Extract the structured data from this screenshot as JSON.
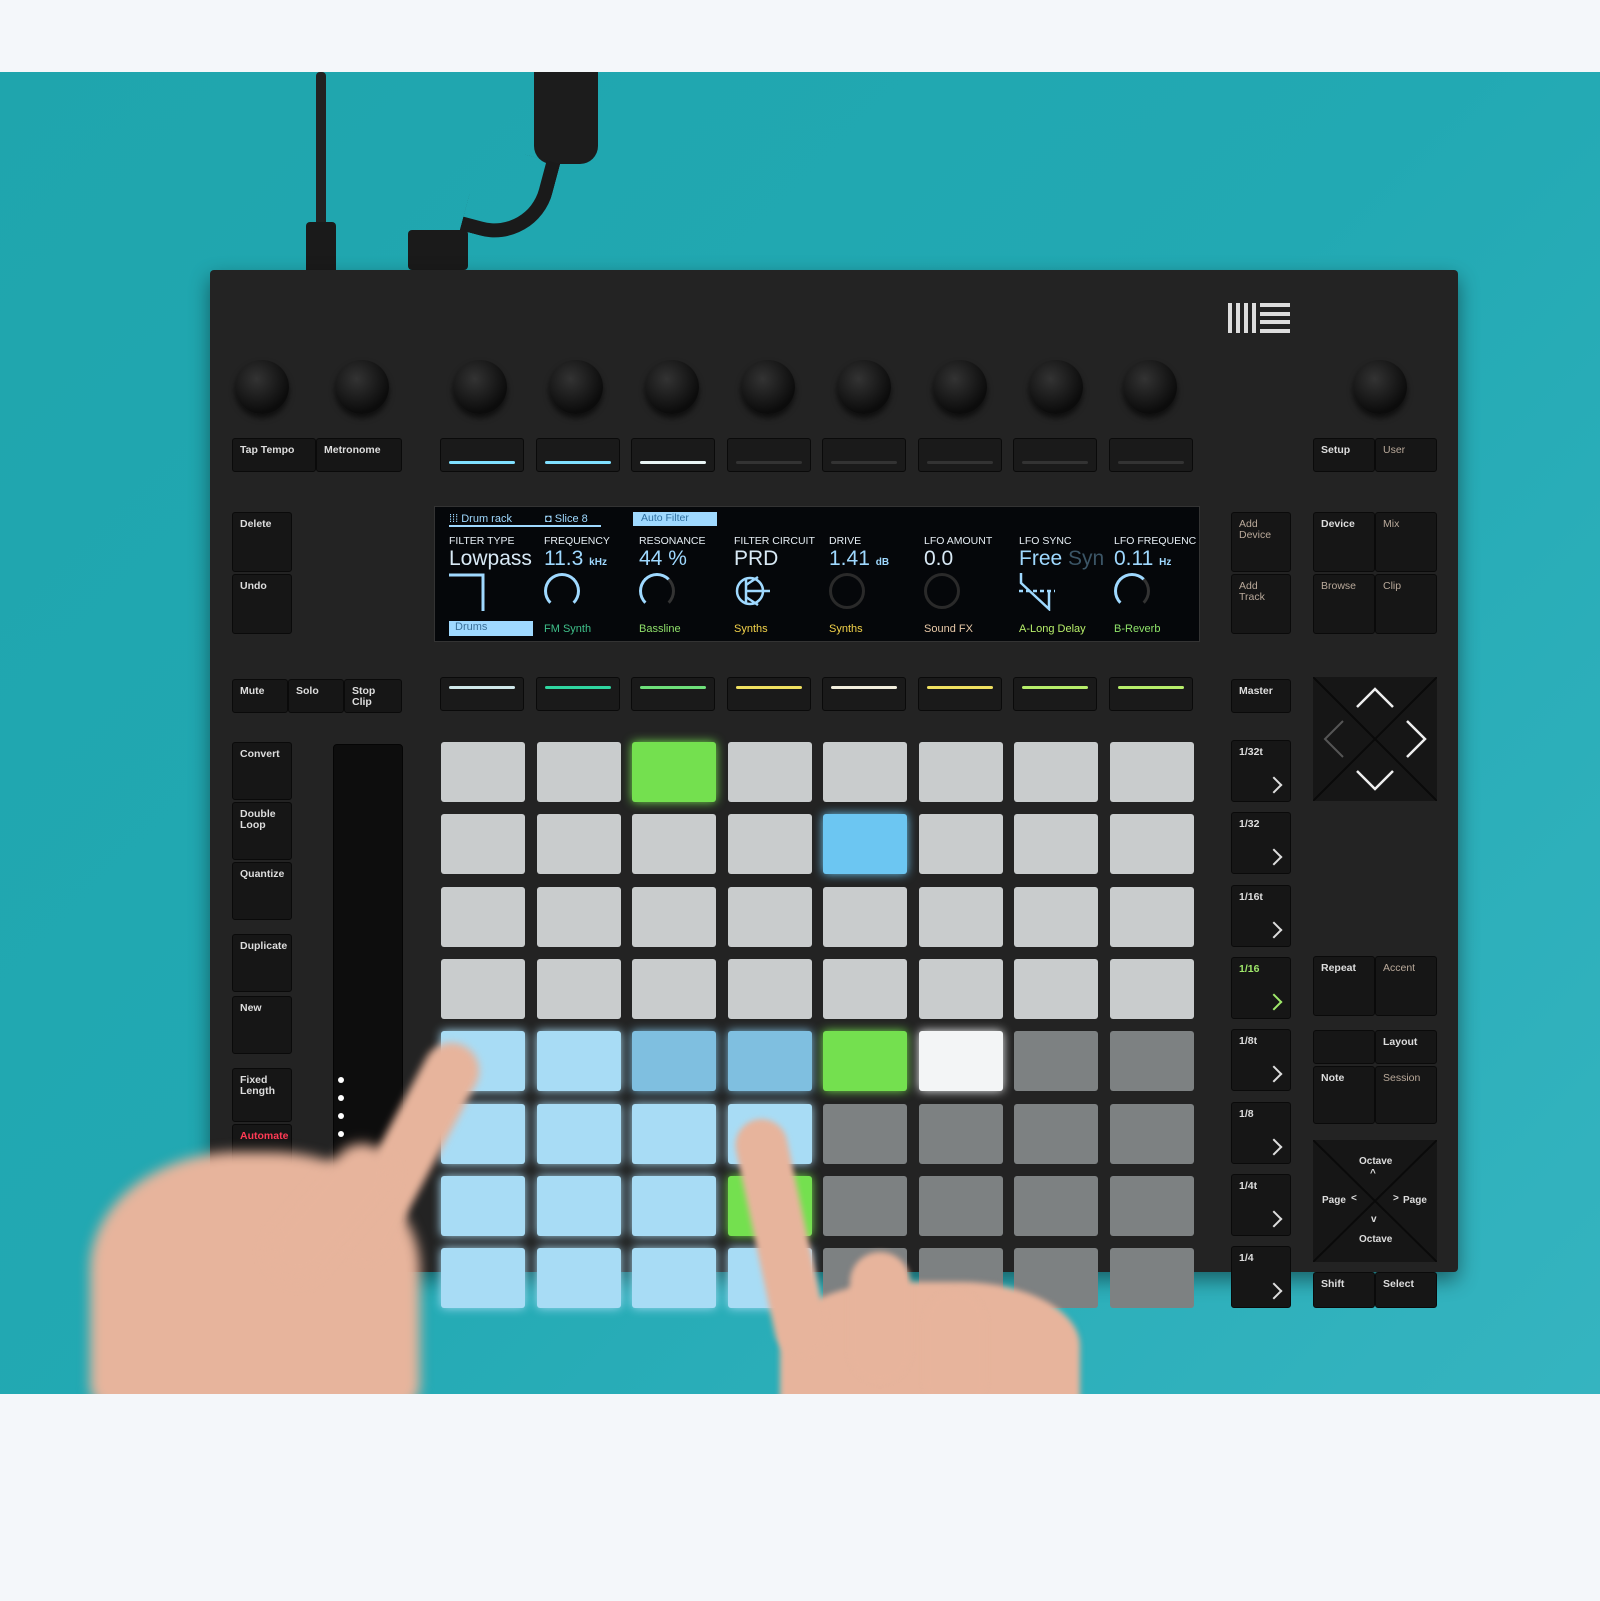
{
  "brand": "Ableton Push",
  "display": {
    "breadcrumb": [
      "Drum rack",
      "Slice 8"
    ],
    "device_tab": "Auto Filter",
    "params": [
      {
        "name": "FILTER TYPE",
        "value": "Lowpass",
        "unit": "",
        "icon": "lowpass-curve-icon"
      },
      {
        "name": "FREQUENCY",
        "value": "11.3",
        "unit": "kHz",
        "icon": "dial-icon"
      },
      {
        "name": "RESONANCE",
        "value": "44 %",
        "unit": "",
        "icon": "dial-icon"
      },
      {
        "name": "FILTER CIRCUIT",
        "value": "PRD",
        "unit": "",
        "icon": "transistor-icon"
      },
      {
        "name": "DRIVE",
        "value": "1.41",
        "unit": "dB",
        "icon": "dial-icon"
      },
      {
        "name": "LFO AMOUNT",
        "value": "0.0",
        "unit": "",
        "icon": "dial-icon"
      },
      {
        "name": "LFO SYNC",
        "value": "Free",
        "unit": "Syn",
        "icon": "lfo-wave-icon"
      },
      {
        "name": "LFO FREQUENC",
        "value": "0.11",
        "unit": "Hz",
        "icon": "dial-icon"
      }
    ],
    "tracks": [
      {
        "label": "Drums",
        "color": "#9fd9ff"
      },
      {
        "label": "FM Synth",
        "color": "#3fc08a"
      },
      {
        "label": "Bassline",
        "color": "#8fe06a"
      },
      {
        "label": "Synths",
        "color": "#f2d24a"
      },
      {
        "label": "Synths",
        "color": "#f2d24a"
      },
      {
        "label": "Sound FX",
        "color": "#e8c9a8"
      },
      {
        "label": "A-Long Delay",
        "color": "#b7ee6a"
      },
      {
        "label": "B-Reverb",
        "color": "#8fe36a"
      }
    ]
  },
  "buttons": {
    "tap_tempo": "Tap Tempo",
    "metronome": "Metronome",
    "delete": "Delete",
    "undo": "Undo",
    "mute": "Mute",
    "solo": "Solo",
    "stop_clip": "Stop\nClip",
    "convert": "Convert",
    "double_loop": "Double\nLoop",
    "quantize": "Quantize",
    "duplicate": "Duplicate",
    "new": "New",
    "fixed_length": "Fixed\nLength",
    "automate": "Automate",
    "setup": "Setup",
    "user": "User",
    "add_device": "Add\nDevice",
    "add_track": "Add\nTrack",
    "device": "Device",
    "mix": "Mix",
    "browse": "Browse",
    "clip": "Clip",
    "master": "Master",
    "repeat": "Repeat",
    "accent": "Accent",
    "layout": "Layout",
    "note": "Note",
    "session": "Session",
    "octave_up": "Octave",
    "octave_down": "Octave",
    "page_left": "Page",
    "page_right": "Page",
    "shift": "Shift",
    "select": "Select"
  },
  "scenes": [
    "1/32t",
    "1/32",
    "1/16t",
    "1/16",
    "1/8t",
    "1/8",
    "1/4t",
    "1/4"
  ],
  "active_scene": "1/16",
  "top_lights": [
    "#7fe0ff",
    "#7fe0ff",
    "#e8f4f4",
    "#333",
    "#333",
    "#333",
    "#333",
    "#333"
  ],
  "bottom_lights": [
    "#d0e8ea",
    "#2fd6a0",
    "#6ee07a",
    "#f0e060",
    "#f2eedd",
    "#f0e060",
    "#b7ee6a",
    "#b7ee6a"
  ],
  "pad_colors": {
    "g": "#c9cccd",
    "d": "#7d8182",
    "G": "#74e04f",
    "B": "#6cc6f2",
    "L": "#a8dcf5",
    "M": "#7fbfe0",
    "W": "#f3f5f6"
  },
  "pads": [
    "ggGggggg",
    "ggggBggg",
    "gggggggg",
    "gggggggg",
    "LLMMGWdd",
    "LLLLdddd",
    "LLLGdddd",
    "LLLLdddd"
  ],
  "colors": {
    "wall": "#22a9b3",
    "device": "#232323",
    "automate": "#ff3b55"
  }
}
